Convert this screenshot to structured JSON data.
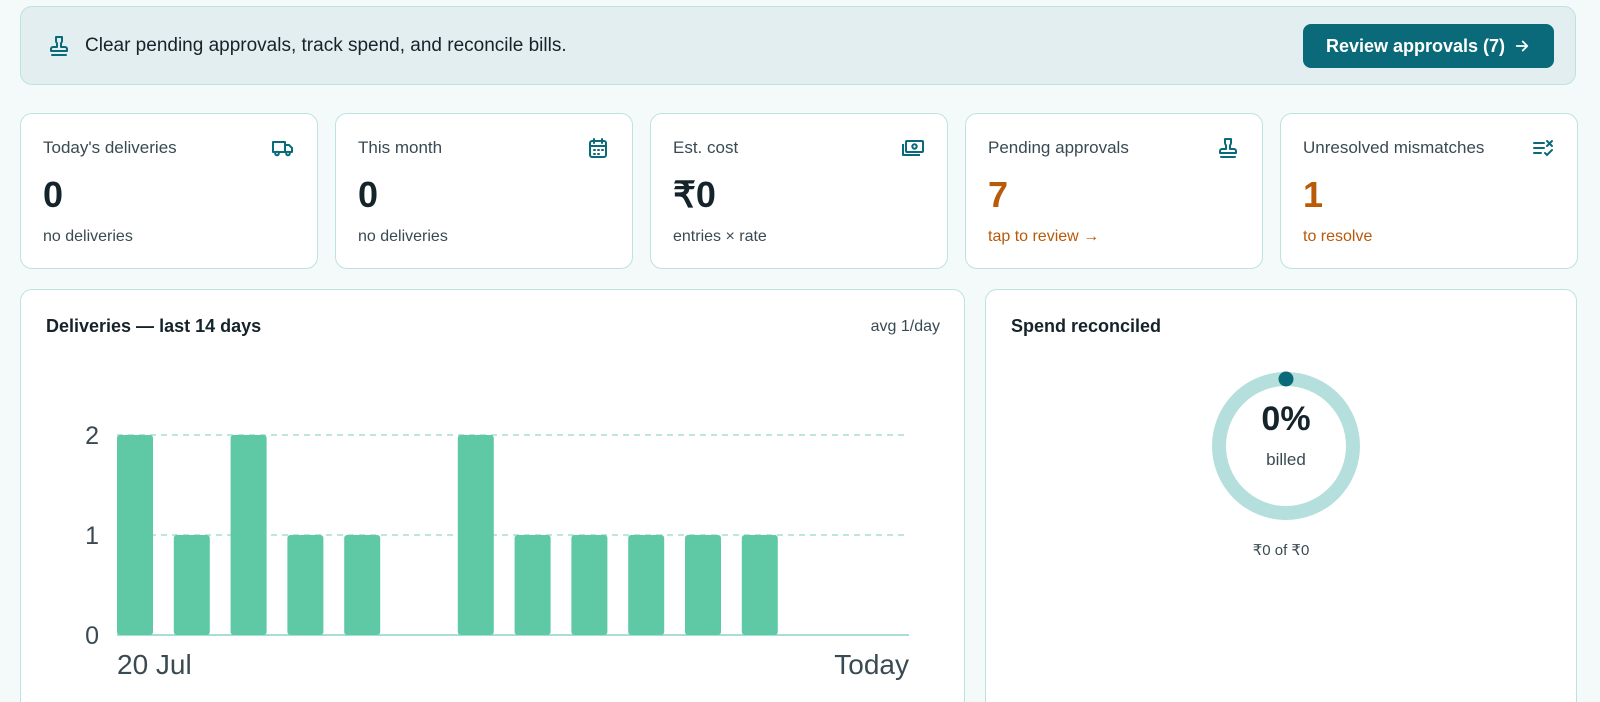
{
  "banner": {
    "icon": "stamp-icon",
    "text": "Clear pending approvals, track spend, and reconcile bills.",
    "button_label": "Review approvals (7)",
    "button_icon": "arrow-right-icon"
  },
  "stats": [
    {
      "label": "Today's deliveries",
      "icon": "truck-icon",
      "value": "0",
      "sub": "no deliveries"
    },
    {
      "label": "This month",
      "icon": "calendar-icon",
      "value": "0",
      "sub": "no deliveries"
    },
    {
      "label": "Est. cost",
      "icon": "cash-icon",
      "value": "₹0",
      "sub": "entries × rate"
    },
    {
      "label": "Pending approvals",
      "icon": "stamp-icon",
      "value": "7",
      "sub": "tap to review →"
    },
    {
      "label": "Unresolved mismatches",
      "icon": "list-x-icon",
      "value": "1",
      "sub": "to resolve"
    }
  ],
  "deliveries_panel": {
    "title": "Deliveries — last 14 days",
    "meta": "avg 1/day"
  },
  "spend_panel": {
    "title": "Spend reconciled",
    "percent": "0%",
    "percent_label": "billed",
    "amount": "₹0 of ₹0",
    "billed_fraction": 0
  },
  "colors": {
    "accent": "#0a6a79",
    "bar": "#5ec9a4",
    "warn": "#b85a08",
    "ring_track": "#b4dfdc",
    "card_border": "#bde3df"
  },
  "chart_data": {
    "type": "bar",
    "categories": [
      "20 Jul",
      "",
      "",
      "",
      "",
      "",
      "",
      "",
      "",
      "",
      "",
      "",
      "",
      "Today"
    ],
    "values": [
      2,
      1,
      2,
      1,
      1,
      0,
      2,
      1,
      1,
      1,
      1,
      1,
      0,
      0
    ],
    "yticks": [
      0,
      1,
      2
    ],
    "ylim": [
      0,
      2
    ],
    "grid": true
  }
}
